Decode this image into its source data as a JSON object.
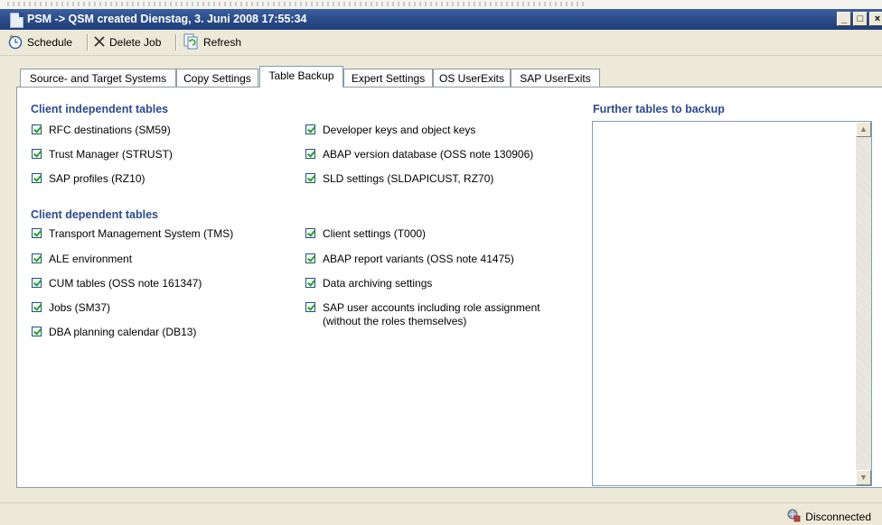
{
  "window": {
    "title": "PSM -> QSM created Dienstag, 3. Juni 2008 17:55:34",
    "minimize": "_",
    "maximize": "□",
    "close": "×"
  },
  "toolbar": {
    "schedule_label": "Schedule",
    "delete_label": "Delete Job",
    "refresh_label": "Refresh"
  },
  "tabs": [
    {
      "label": "Source- and Target Systems"
    },
    {
      "label": "Copy Settings"
    },
    {
      "label": "Table Backup"
    },
    {
      "label": "Expert Settings"
    },
    {
      "label": "OS UserExits"
    },
    {
      "label": "SAP UserExits"
    }
  ],
  "active_tab": "Table Backup",
  "client_independent": {
    "heading": "Client independent tables",
    "col1": [
      {
        "label": "RFC destinations (SM59)",
        "checked": true
      },
      {
        "label": "Trust Manager (STRUST)",
        "checked": true
      },
      {
        "label": "SAP profiles (RZ10)",
        "checked": true
      }
    ],
    "col2": [
      {
        "label": "Developer keys and object keys",
        "checked": true
      },
      {
        "label": "ABAP version database (OSS note 130906)",
        "checked": true
      },
      {
        "label": "SLD settings (SLDAPICUST, RZ70)",
        "checked": true
      }
    ]
  },
  "client_dependent": {
    "heading": "Client dependent tables",
    "col1": [
      {
        "label": "Transport Management System (TMS)",
        "checked": true
      },
      {
        "label": "ALE environment",
        "checked": true
      },
      {
        "label": "CUM tables (OSS note 161347)",
        "checked": true
      },
      {
        "label": "Jobs (SM37)",
        "checked": true
      },
      {
        "label": "DBA planning calendar (DB13)",
        "checked": true
      }
    ],
    "col2": [
      {
        "label": "Client settings (T000)",
        "checked": true
      },
      {
        "label": "ABAP report variants (OSS note 41475)",
        "checked": true
      },
      {
        "label": "Data archiving settings",
        "checked": true
      },
      {
        "label": "SAP user accounts including role assignment (without the roles themselves)",
        "checked": true
      }
    ]
  },
  "further_tables": {
    "heading": "Further tables to backup",
    "items": []
  },
  "status": {
    "text": "Disconnected"
  }
}
